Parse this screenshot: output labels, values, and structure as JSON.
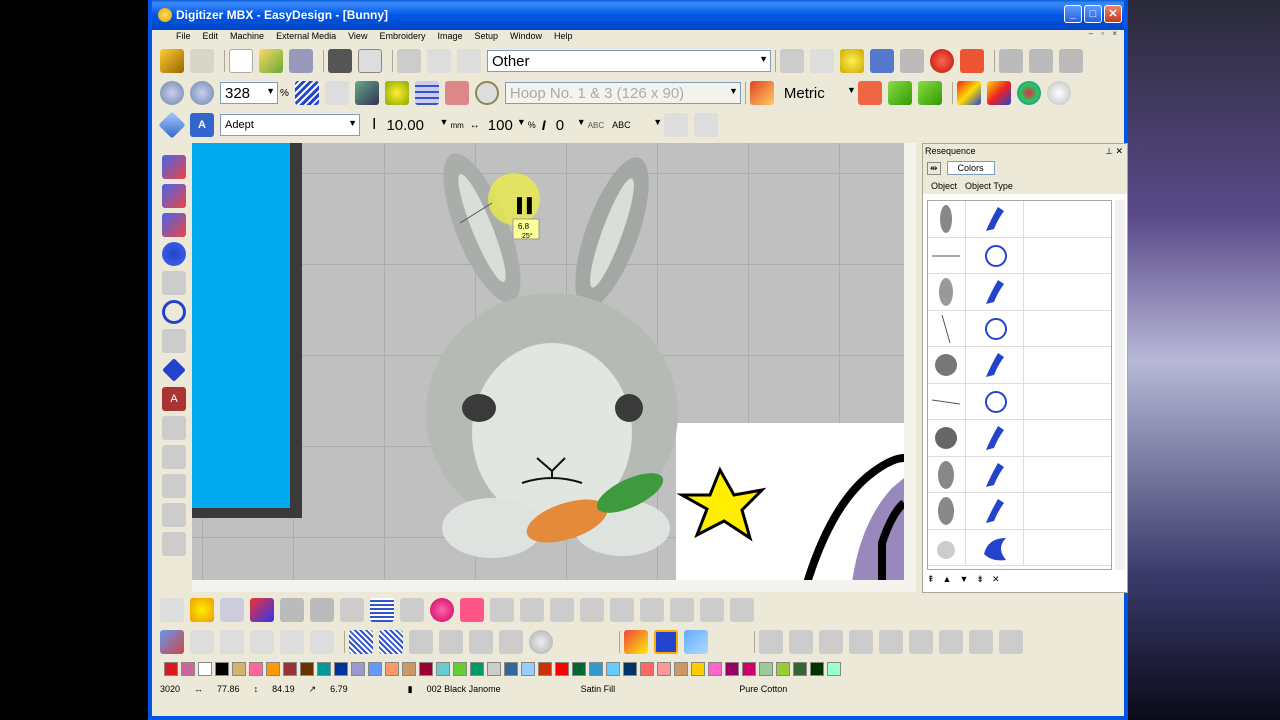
{
  "window": {
    "title": "Digitizer MBX - EasyDesign - [Bunny]"
  },
  "menu": [
    "File",
    "Edit",
    "Machine",
    "External Media",
    "View",
    "Embroidery",
    "Image",
    "Setup",
    "Window",
    "Help"
  ],
  "toolbar": {
    "design_category": "Other",
    "zoom_value": "328",
    "zoom_unit": "%",
    "hoop": "Hoop No. 1 & 3 (126 x 90)",
    "units": "Metric"
  },
  "text_toolbar": {
    "font": "Adept",
    "height": "10.00",
    "height_unit": "mm",
    "width": "100",
    "width_unit": "%",
    "slant": "0",
    "abc_label": "ABC"
  },
  "cursor_tip": {
    "length": "6.8",
    "angle": "25°"
  },
  "resequence_panel": {
    "title": "Resequence",
    "colors_tab": "Colors",
    "col_object": "Object",
    "col_object_type": "Object Type"
  },
  "palette": [
    "#d91a1a",
    "#cc6699",
    "#ffffff",
    "#000000",
    "#d4b26a",
    "#ff6699",
    "#ff9900",
    "#993333",
    "#663300",
    "#009999",
    "#003399",
    "#9999cc",
    "#6699ff",
    "#ff9966",
    "#cc9966",
    "#990033",
    "#66cccc",
    "#66cc33",
    "#009966",
    "#cccccc",
    "#336699",
    "#99ccff",
    "#cc3300",
    "#ff0000",
    "#006633",
    "#3399cc",
    "#66ccff",
    "#003366",
    "#ff6666",
    "#ff9999",
    "#cc9966",
    "#ffcc00",
    "#ff66cc",
    "#990066",
    "#cc0066",
    "#99cc99",
    "#99cc33",
    "#336633",
    "#003300",
    "#99ffcc"
  ],
  "status": {
    "stitches": "3020",
    "width": "77.86",
    "height": "84.19",
    "stitch_len": "6.79",
    "thread": "002 Black Janome",
    "fill": "Satin Fill",
    "material": "Pure Cotton"
  }
}
